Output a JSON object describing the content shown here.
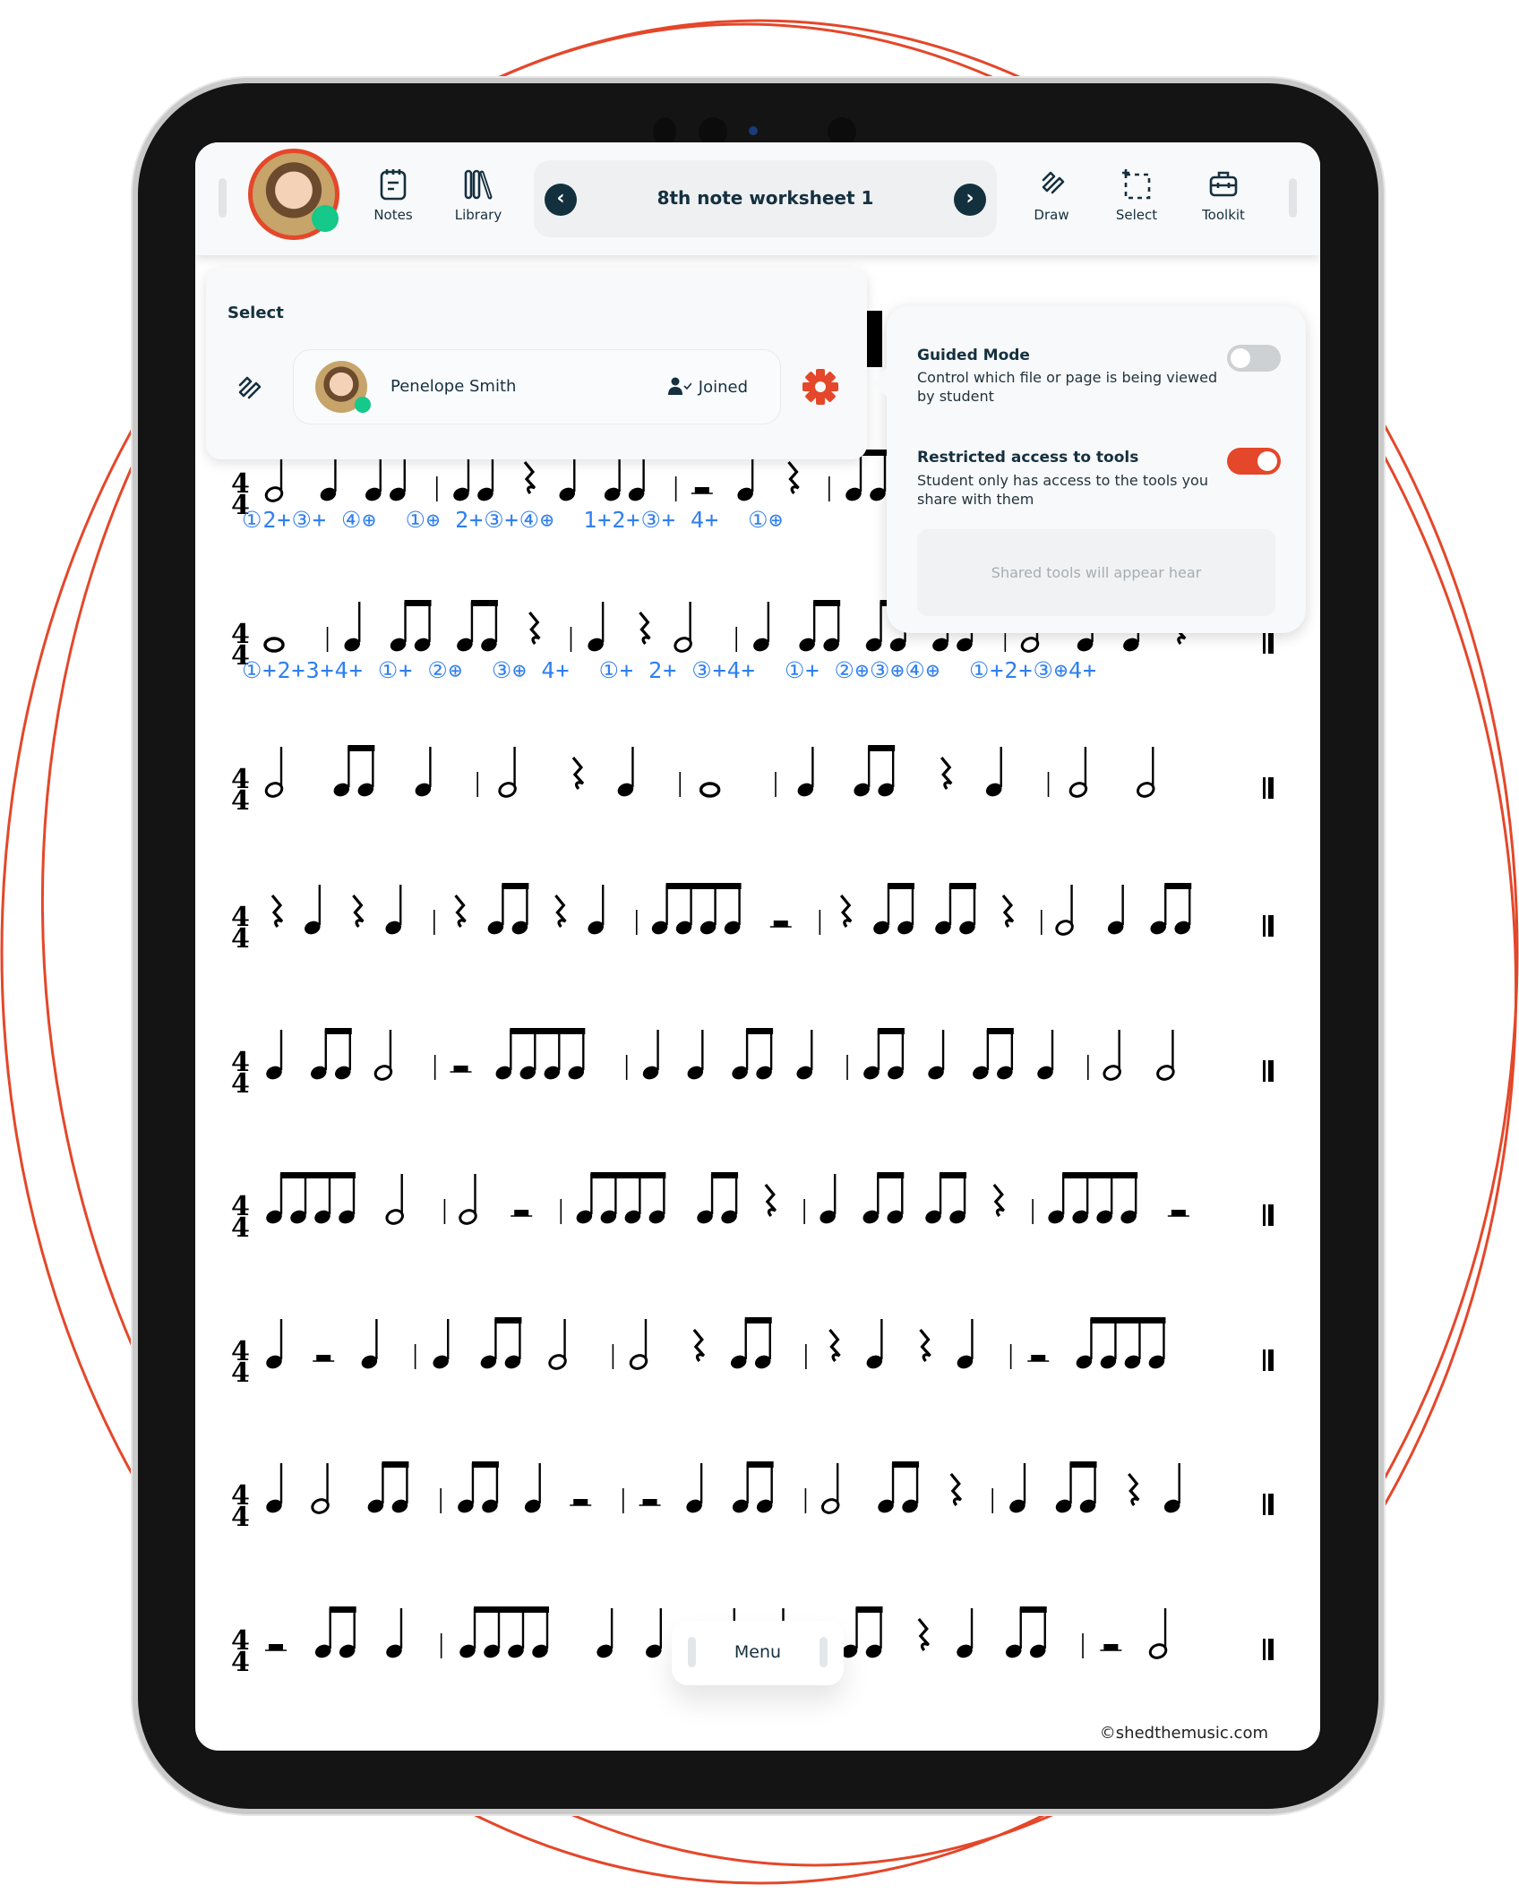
{
  "toolbar": {
    "notes_label": "Notes",
    "library_label": "Library",
    "document_title": "8th note worksheet 1",
    "draw_label": "Draw",
    "select_label": "Select",
    "toolkit_label": "Toolkit",
    "student_online": true
  },
  "select_panel": {
    "heading": "Select",
    "student_name": "Penelope Smith",
    "status": "Joined"
  },
  "settings_panel": {
    "guided_mode": {
      "title": "Guided Mode",
      "description": "Control which file or page is being viewed by student",
      "enabled": false
    },
    "restricted_tools": {
      "title": "Restricted access to tools",
      "description": "Student only has access to the tools you share with them",
      "enabled": true
    },
    "shared_tools_placeholder": "Shared tools will appear hear"
  },
  "menu_label": "Menu",
  "copyright": "©shedthemusic.com",
  "colors": {
    "accent": "#e4472a",
    "navy": "#13303f",
    "online": "#14c98a",
    "annotation": "#2f7ff0"
  },
  "sheet": {
    "time_signature": [
      "4",
      "4"
    ],
    "rows": [
      "h q e | e r q e | H q r | e e q q q h q ||",
      "w | q e e r | q r h | q e e e | h q q r ||",
      "h e q | h r q | w | q e r q | h h ||",
      "r q r q | r e r q | e4 H | r e e r | h q e ||",
      "q e h | H e4 | q q e q | e q e q | h h ||",
      "e4 h | h H | e4 e r | q e e r | e4 H ||",
      "q H q | q e h | h r e | r q r q | H e4 ||",
      "q h e | e q H | H q e | h e r | q e r q ||",
      "H e q | e4 q q | q q | e r q e | H h ||"
    ],
    "annotations": [
      "①2+③+ ④⊕  ①⊕ 2+③+④⊕  1+2+③+ 4+  ①⊕",
      "①+2+3+4+ ①+ ②⊕  ③⊕ 4+  ①+ 2+ ③+4+  ①+ ②⊕③⊕④⊕  ①+2+③⊕4+"
    ]
  }
}
